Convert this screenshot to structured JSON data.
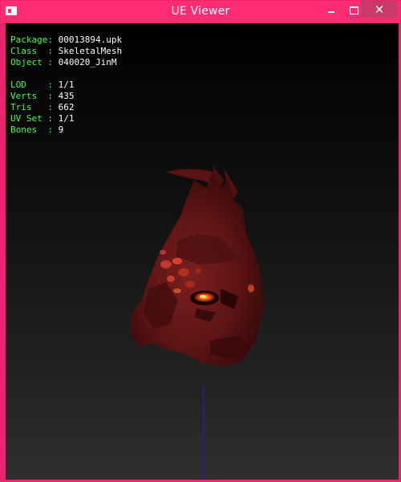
{
  "window": {
    "title": "UE Viewer",
    "controls": {
      "minimize": "minimize",
      "maximize": "maximize",
      "close": "✕"
    },
    "accent_color": "#ff2b73"
  },
  "info": {
    "object_section": [
      {
        "label": "Package:",
        "value": "00013894.upk"
      },
      {
        "label": "Class  :",
        "value": "SkeletalMesh"
      },
      {
        "label": "Object :",
        "value": "040020_JinM"
      }
    ],
    "mesh_section": [
      {
        "label": "LOD    :",
        "value": "1/1"
      },
      {
        "label": "Verts  :",
        "value": "435"
      },
      {
        "label": "Tris   :",
        "value": "662"
      },
      {
        "label": "UV Set :",
        "value": "1/1"
      },
      {
        "label": "Bones  :",
        "value": "9"
      }
    ],
    "label_color": "#40ff40",
    "value_color": "#ffffff"
  },
  "viewport": {
    "model": "skeletal-mesh-head",
    "axis_color": "#1a1ad8"
  }
}
